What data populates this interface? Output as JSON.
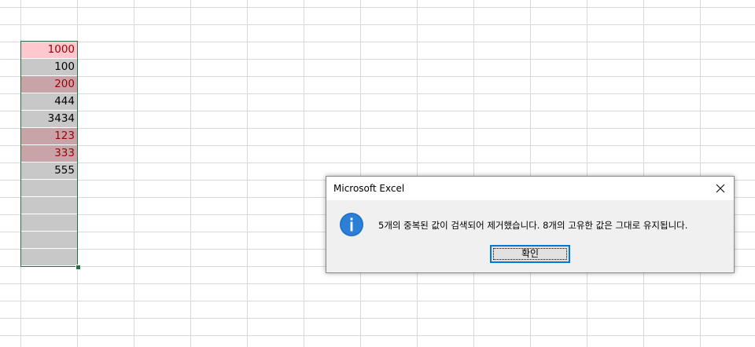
{
  "sheet": {
    "cells": [
      {
        "value": "1000",
        "fill": "#ffc7ce",
        "color": "#9c0006"
      },
      {
        "value": "100",
        "fill": "#c8c8c8",
        "color": "#000000"
      },
      {
        "value": "200",
        "fill": "#c8a4a8",
        "color": "#9c0006"
      },
      {
        "value": "444",
        "fill": "#c8c8c8",
        "color": "#000000"
      },
      {
        "value": "3434",
        "fill": "#c8c8c8",
        "color": "#000000"
      },
      {
        "value": "123",
        "fill": "#c8a4a8",
        "color": "#9c0006"
      },
      {
        "value": "333",
        "fill": "#c8a4a8",
        "color": "#9c0006"
      },
      {
        "value": "555",
        "fill": "#c8c8c8",
        "color": "#000000"
      },
      {
        "value": "",
        "fill": "#c8c8c8",
        "color": "#000000"
      },
      {
        "value": "",
        "fill": "#c8c8c8",
        "color": "#000000"
      },
      {
        "value": "",
        "fill": "#c8c8c8",
        "color": "#000000"
      },
      {
        "value": "",
        "fill": "#c8c8c8",
        "color": "#000000"
      },
      {
        "value": "",
        "fill": "#c8c8c8",
        "color": "#000000"
      }
    ],
    "selection_color": "#217346",
    "gridline_color": "#d9d9d9"
  },
  "dialog": {
    "title": "Microsoft Excel",
    "message": "5개의 중복된 값이 검색되어 제거했습니다. 8개의 고유한 값은 그대로 유지됩니다.",
    "ok_label": "확인",
    "icon": "info-icon",
    "close_icon": "close-icon",
    "accent_color": "#0078d7"
  }
}
